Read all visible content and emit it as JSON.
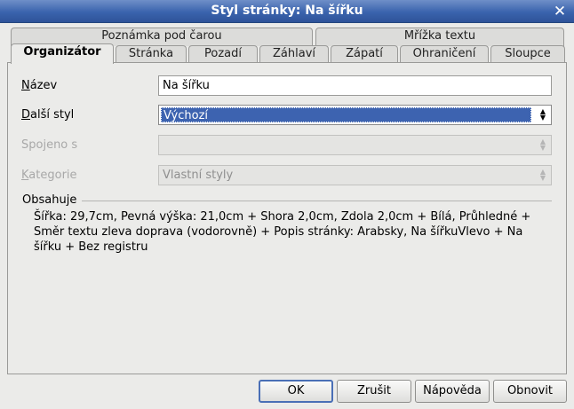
{
  "window": {
    "title": "Styl stránky: Na šířku",
    "close_icon": "close-icon"
  },
  "tabs_row_back": [
    {
      "label": "Poznámka pod čarou"
    },
    {
      "label": "Mřížka textu"
    }
  ],
  "tabs_row_front": [
    {
      "label": "Organizátor",
      "active": true
    },
    {
      "label": "Stránka"
    },
    {
      "label": "Pozadí"
    },
    {
      "label": "Záhlaví"
    },
    {
      "label": "Zápatí"
    },
    {
      "label": "Ohraničení"
    },
    {
      "label": "Sloupce"
    }
  ],
  "form": {
    "name_label": "Název",
    "name_value": "Na šířku",
    "next_style_label": "Další styl",
    "next_style_value": "Výchozí",
    "linked_label": "Spojeno s",
    "linked_value": "",
    "category_label": "Kategorie",
    "category_value": "Vlastní styly"
  },
  "contains": {
    "title": "Obsahuje",
    "text": "Šířka: 29,7cm, Pevná výška: 21,0cm + Shora 2,0cm, Zdola 2,0cm + Bílá, Průhledné + Směr textu zleva doprava (vodorovně) + Popis stránky: Arabsky, Na šířkuVlevo + Na šířku + Bez registru"
  },
  "buttons": {
    "ok": "OK",
    "cancel": "Zrušit",
    "help": "Nápověda",
    "reset": "Obnovit"
  },
  "colors": {
    "titlebar": "#3a63ad",
    "selection": "#3d63b0",
    "default_button_border": "#4a6fb6"
  }
}
